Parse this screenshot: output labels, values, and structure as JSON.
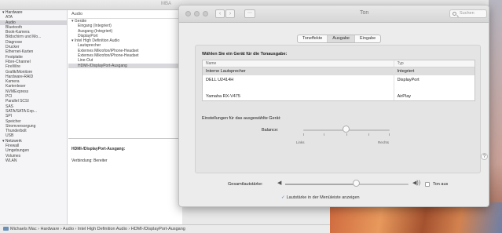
{
  "sysinfo": {
    "window_title": "MBA",
    "header": "Audio",
    "sidebar_items": [
      {
        "label": "▾ Hardware",
        "group": true
      },
      {
        "label": "ATA"
      },
      {
        "label": "Audio",
        "selected": true
      },
      {
        "label": "Bluetooth"
      },
      {
        "label": "Book-Kamera"
      },
      {
        "label": "Bildschirm und Mo..."
      },
      {
        "label": "Diagnose"
      },
      {
        "label": "Drucker"
      },
      {
        "label": "Ethernet-Karten"
      },
      {
        "label": "Festplatte"
      },
      {
        "label": "Fibre-Channel"
      },
      {
        "label": "FireWire"
      },
      {
        "label": "Grafik/Monitore"
      },
      {
        "label": "Hardware-RAID"
      },
      {
        "label": "Kamera"
      },
      {
        "label": "Kartenleser"
      },
      {
        "label": "NVMExpress"
      },
      {
        "label": "PCI"
      },
      {
        "label": "Parallel SCSI"
      },
      {
        "label": "SAS"
      },
      {
        "label": "SATA/SATA Exp..."
      },
      {
        "label": "SPI"
      },
      {
        "label": "Speicher"
      },
      {
        "label": "Stromversorgung"
      },
      {
        "label": "Thunderbolt"
      },
      {
        "label": "USB"
      },
      {
        "label": "▾ Netzwerk",
        "group": true
      },
      {
        "label": "Firewall"
      },
      {
        "label": "Umgebungen"
      },
      {
        "label": "Volumes"
      },
      {
        "label": "WLAN"
      }
    ],
    "tree": [
      {
        "label": "▾ Geräte",
        "indent": 1
      },
      {
        "label": "Eingang (Integriert)",
        "indent": 3
      },
      {
        "label": "Ausgang (Integriert)",
        "indent": 3
      },
      {
        "label": "DisplayPort",
        "indent": 3
      },
      {
        "label": "▾ Intel High Definition Audio",
        "indent": 1
      },
      {
        "label": "Lautsprecher",
        "indent": 3
      },
      {
        "label": "Externes Mikrofon/iPhone-Headset",
        "indent": 3
      },
      {
        "label": "Externes Mikrofon/iPhone-Headset",
        "indent": 3
      },
      {
        "label": "Line-Out",
        "indent": 3
      },
      {
        "label": "HDMI-/DisplayPort-Ausgang",
        "indent": 3,
        "selected": true
      }
    ],
    "detail_title": "HDMI-/DisplayPort-Ausgang:",
    "detail_line": "Verbindung:   Bereiter",
    "breadcrumb": "Michaels Mac  ›  Hardware  ›  Audio  ›  Intel High Definition Audio  ›  HDMI-/DisplayPort-Ausgang"
  },
  "sound": {
    "window_title": "Ton",
    "nav_back": "‹",
    "nav_forward": "›",
    "grid_glyph": "⋯",
    "search_placeholder": "Suchen",
    "tabs": [
      {
        "label": "Toneffekte",
        "active": false
      },
      {
        "label": "Ausgabe",
        "active": true
      },
      {
        "label": "Eingabe",
        "active": false
      }
    ],
    "heading": "Wählen Sie ein Gerät für die Tonausgabe:",
    "columns": [
      "Name",
      "Typ"
    ],
    "devices": [
      {
        "name": "Interne Lautsprecher",
        "type": "Integriert",
        "selected": true
      },
      {
        "name": "DELL U2414H",
        "type": "DisplayPort",
        "selected": false
      },
      {
        "name": "",
        "type": "",
        "selected": false
      },
      {
        "name": "Yamaha RX-V475",
        "type": "AirPlay",
        "selected": false
      }
    ],
    "settings_label": "Einstellungen für das ausgewählte Gerät:",
    "balance_label": "Balance:",
    "balance_value": 0.5,
    "left_label": "Links",
    "right_label": "Rechts",
    "help": "?",
    "volume_label": "Gesamtlautstärke:",
    "volume_low_glyph": "◀",
    "volume_high_glyph": "◀))",
    "volume_value": 0.58,
    "mute_label": "Ton aus",
    "mute_checked": false,
    "menubar_label": "Lautstärke in der Menüleiste anzeigen",
    "menubar_checked": true,
    "check_glyph": "✓"
  }
}
